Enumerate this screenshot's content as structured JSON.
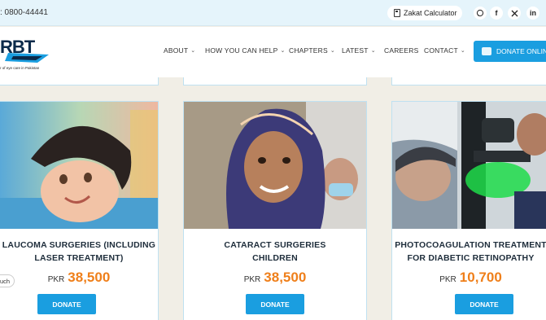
{
  "topbar": {
    "phone": ": 0800-44441",
    "zakat_label": "Zakat Calculator",
    "social": [
      "whatsapp-icon",
      "facebook-icon",
      "twitter-icon",
      "linkedin-icon"
    ]
  },
  "header": {
    "logo_text": "RBT",
    "logo_tagline": "r of eye care in Pakistan",
    "nav": [
      {
        "label": "ABOUT",
        "dropdown": true
      },
      {
        "label": "HOW YOU CAN HELP",
        "dropdown": true
      },
      {
        "label": "CHAPTERS",
        "dropdown": true
      },
      {
        "label": "LATEST",
        "dropdown": true
      },
      {
        "label": "CAREERS",
        "dropdown": false
      },
      {
        "label": "CONTACT",
        "dropdown": true
      }
    ],
    "donate_online": "DONATE ONLINE"
  },
  "cards": [
    {
      "title_line1": "LAUCOMA SURGERIES (INCLUDING",
      "title_line2": "LASER TREATMENT)",
      "currency": "PKR",
      "amount": "38,500",
      "button": "DONATE"
    },
    {
      "title_line1": "CATARACT SURGERIES",
      "title_line2": "CHILDREN",
      "currency": "PKR",
      "amount": "38,500",
      "button": "DONATE"
    },
    {
      "title_line1": "PHOTOCOAGULATION TREATMENT",
      "title_line2": "FOR DIABETIC RETINOPATHY",
      "currency": "PKR",
      "amount": "10,700",
      "button": "DONATE"
    }
  ],
  "touch_tab": "uch",
  "colors": {
    "accent": "#1a9ee0",
    "price": "#ef7f1a",
    "page_bg": "#f1eee6",
    "topbar_bg": "#e5f4fb"
  }
}
